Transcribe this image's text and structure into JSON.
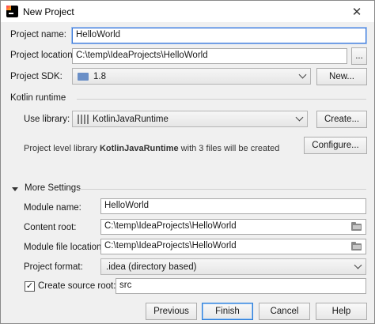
{
  "window": {
    "title": "New Project"
  },
  "project": {
    "name_label": "Project name:",
    "name_value": "HelloWorld",
    "location_label": "Project location:",
    "location_value": "C:\\temp\\IdeaProjects\\HelloWorld",
    "browse_label": "...",
    "sdk_label": "Project SDK:",
    "sdk_value": "1.8",
    "new_label": "New..."
  },
  "kotlin": {
    "section_label": "Kotlin runtime",
    "use_library_label": "Use library:",
    "library_value": "KotlinJavaRuntime",
    "create_label": "Create...",
    "info_prefix": "Project level library ",
    "info_library": "KotlinJavaRuntime",
    "info_suffix": " with 3 files will be created",
    "configure_label": "Configure..."
  },
  "more_settings": {
    "section_label": "More Settings",
    "module_name_label": "Module name:",
    "module_name_value": "HelloWorld",
    "content_root_label": "Content root:",
    "content_root_value": "C:\\temp\\IdeaProjects\\HelloWorld",
    "module_file_label": "Module file location:",
    "module_file_value": "C:\\temp\\IdeaProjects\\HelloWorld",
    "project_format_label": "Project format:",
    "project_format_value": ".idea (directory based)",
    "create_source_root_label": "Create source root:",
    "create_source_root_checked": true,
    "source_root_value": "src"
  },
  "footer": {
    "previous_label": "Previous",
    "finish_label": "Finish",
    "cancel_label": "Cancel",
    "help_label": "Help"
  },
  "icons": {
    "app": "intellij-icon",
    "close": "close-icon",
    "folder": "folder-icon",
    "sdk": "sdk-folder-icon",
    "library": "library-icon",
    "collapse": "triangle-down-icon",
    "check": "check-icon"
  }
}
